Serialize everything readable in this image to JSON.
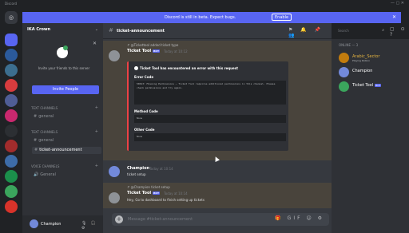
{
  "window": {
    "title": "Discord",
    "controls": "— ▢ ✕"
  },
  "banner": {
    "text": "Discord is still in beta. Expect bugs.",
    "button": "Enable",
    "close": "✕"
  },
  "guilds": [
    {
      "kind": "home",
      "label": "◎",
      "color": "#36393f"
    },
    {
      "kind": "active",
      "label": "",
      "color": "#5865f2"
    },
    {
      "kind": "server",
      "label": "",
      "color": "#2b5a9c"
    },
    {
      "kind": "server",
      "label": "",
      "color": "#3c6e8f"
    },
    {
      "kind": "server",
      "label": "",
      "color": "#d83c3e"
    },
    {
      "kind": "server",
      "label": "",
      "color": "#4f5d95"
    },
    {
      "kind": "server",
      "label": "",
      "color": "#c9286e"
    },
    {
      "kind": "server",
      "label": "",
      "color": "#2c2f33"
    },
    {
      "kind": "server",
      "label": "",
      "color": "#a22c2c"
    },
    {
      "kind": "server",
      "label": "",
      "color": "#3d6ca8"
    },
    {
      "kind": "server",
      "label": "",
      "color": "#1b8f4b"
    },
    {
      "kind": "server",
      "label": "",
      "color": "#3ba55d"
    },
    {
      "kind": "server",
      "label": "",
      "color": "#d8332a"
    }
  ],
  "server": {
    "name": "IKA Crown",
    "chevron": "⌄",
    "invite_close": "✕",
    "invite_message": "Invite your friends to this server",
    "invite_button": "Invite People",
    "categories": [
      {
        "label": "TEXT CHANNELS",
        "plus": "+"
      },
      {
        "label": "TEXT CHANNELS",
        "plus": "+"
      },
      {
        "label": "VOICE CHANNELS",
        "plus": "+"
      }
    ],
    "channels": [
      {
        "hash": "#",
        "name": "general"
      },
      {
        "hash": "#",
        "name": "general"
      },
      {
        "hash": "#",
        "name": "ticket-announcement"
      },
      {
        "hash": "🔊",
        "name": "General"
      }
    ]
  },
  "user": {
    "name": "Champion",
    "controls": "🎙 🎧 ⚙"
  },
  "chat": {
    "hash": "#",
    "channel": "ticket-announcement",
    "header_icons": "⚑ 🔔 📌 👥",
    "search_placeholder": "Search",
    "search_icon": "⌕",
    "right_icons": "▢ ⊙ ?",
    "messages": [
      {
        "reply": "↱ @Tickettool added ticket type",
        "author": "Ticket Tool",
        "badge": "BOT",
        "time": "Today at 10:12",
        "embed": {
          "title": "Ticket Tool has encountered an error with this request",
          "field1": "Error Code",
          "code1": "50013: Missing Permissions — Ticket Tool requires additional permissions in this channel. Please check permissions and try again.",
          "field2": "Method Code",
          "code2": "None",
          "field3": "Other Code",
          "code3": "None"
        }
      },
      {
        "author": "Champion",
        "time": "Today at 10:14",
        "text": "ticket setup"
      },
      {
        "reply": "↱ @Champion ticket setup",
        "author": "Ticket Tool",
        "badge": "BOT",
        "time": "Today at 10:14",
        "text": "Hey, Go to dashboard to finish setting up tickets"
      }
    ],
    "composer_placeholder": "Message #ticket-announcement",
    "composer_tools": "🎁 GIF ☺ ⚙"
  },
  "members": {
    "heading": "ONLINE — 3",
    "list": [
      {
        "name": "Arabic_Sector",
        "sub": "Playing Roblox",
        "color": "#e3b341",
        "avatar": "#c27c0e"
      },
      {
        "name": "Champion",
        "sub": "",
        "color": "#ffffff",
        "avatar": "#7289da"
      },
      {
        "name": "Ticket Tool",
        "sub": "",
        "color": "#ffffff",
        "avatar": "#3ba55d"
      }
    ]
  }
}
